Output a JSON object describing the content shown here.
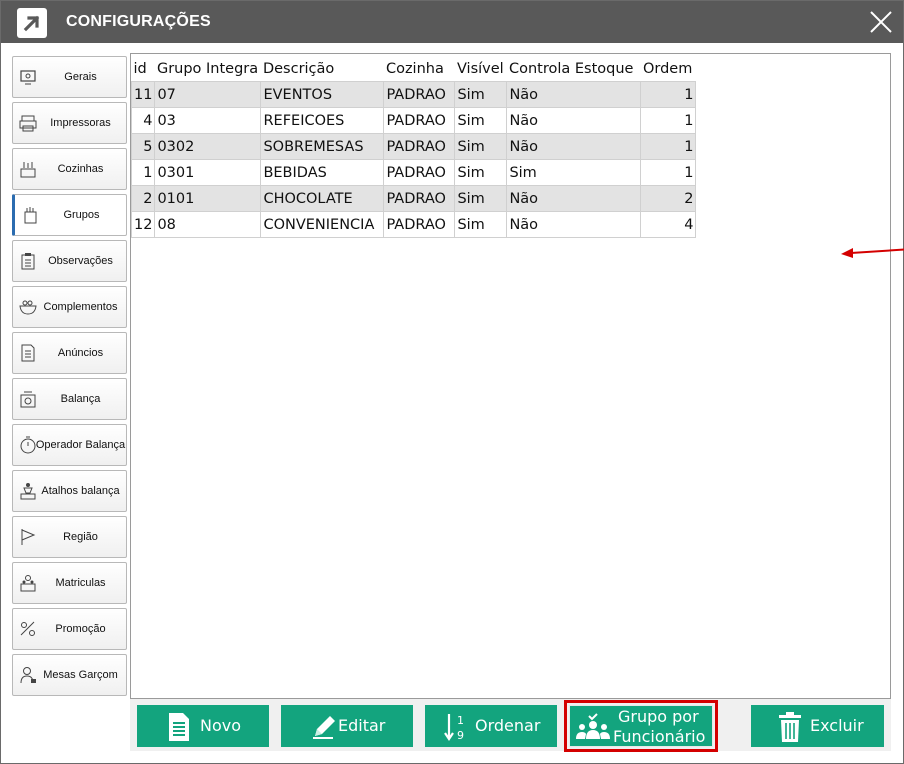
{
  "window": {
    "title": "CONFIGURAÇÕES"
  },
  "sidebar": {
    "items": [
      {
        "label": "Gerais",
        "icon": "settings-monitor-icon"
      },
      {
        "label": "Impressoras",
        "icon": "printer-icon"
      },
      {
        "label": "Cozinhas",
        "icon": "kitchen-icon"
      },
      {
        "label": "Grupos",
        "icon": "groups-icon",
        "active": true
      },
      {
        "label": "Observações",
        "icon": "clipboard-icon"
      },
      {
        "label": "Complementos",
        "icon": "bowl-icon"
      },
      {
        "label": "Anúncios",
        "icon": "document-icon"
      },
      {
        "label": "Balança",
        "icon": "scale-icon"
      },
      {
        "label": "Operador  Balança",
        "icon": "timer-icon"
      },
      {
        "label": "Atalhos balança",
        "icon": "scale-person-icon"
      },
      {
        "label": "Região",
        "icon": "flag-icon"
      },
      {
        "label": "Matriculas",
        "icon": "people-icon"
      },
      {
        "label": "Promoção",
        "icon": "promotion-icon"
      },
      {
        "label": "Mesas Garçom",
        "icon": "waiter-icon"
      }
    ]
  },
  "table": {
    "columns": [
      "id",
      "Grupo Integra",
      "Descrição",
      "Cozinha",
      "Visível",
      "Controla Estoque",
      "Ordem"
    ],
    "rows": [
      {
        "id": "11",
        "grupo": "07",
        "descricao": "EVENTOS",
        "cozinha": "PADRAO",
        "visivel": "Sim",
        "estoque": "Não",
        "ordem": "1",
        "shaded": true
      },
      {
        "id": "4",
        "grupo": "03",
        "descricao": "REFEICOES",
        "cozinha": "PADRAO",
        "visivel": "Sim",
        "estoque": "Não",
        "ordem": "1",
        "shaded": false
      },
      {
        "id": "5",
        "grupo": "0302",
        "descricao": "SOBREMESAS",
        "cozinha": "PADRAO",
        "visivel": "Sim",
        "estoque": "Não",
        "ordem": "1",
        "shaded": true
      },
      {
        "id": "1",
        "grupo": "0301",
        "descricao": "BEBIDAS",
        "cozinha": "PADRAO",
        "visivel": "Sim",
        "estoque": "Sim",
        "ordem": "1",
        "shaded": false
      },
      {
        "id": "2",
        "grupo": "0101",
        "descricao": "CHOCOLATE",
        "cozinha": "PADRAO",
        "visivel": "Sim",
        "estoque": "Não",
        "ordem": "2",
        "shaded": true
      },
      {
        "id": "12",
        "grupo": "08",
        "descricao": "CONVENIENCIA",
        "cozinha": "PADRAO",
        "visivel": "Sim",
        "estoque": "Não",
        "ordem": "4",
        "shaded": false
      }
    ]
  },
  "toolbar": {
    "novo": "Novo",
    "editar": "Editar",
    "ordenar": "Ordenar",
    "grupo_line1": "Grupo por",
    "grupo_line2": "Funcionário",
    "excluir": "Excluir"
  },
  "colors": {
    "titlebar": "#595959",
    "button": "#13a47e",
    "highlight": "#d40000",
    "row_shade": "#e3e3e3"
  }
}
